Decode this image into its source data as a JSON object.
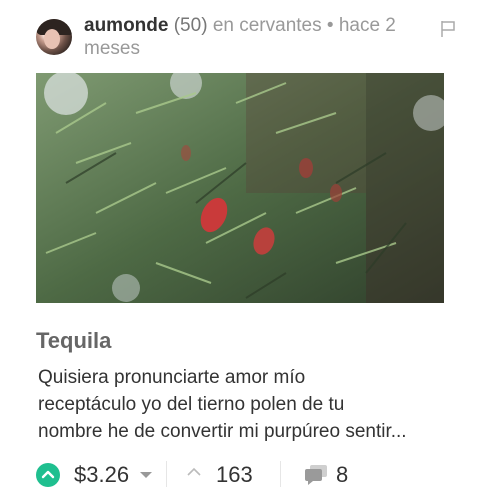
{
  "post": {
    "author": "aumonde",
    "reputation": "(50)",
    "community_prefix": "en",
    "community": "cervantes",
    "separator": "•",
    "time_line1": "hace 2",
    "time_line2": "meses",
    "title": "Tequila",
    "excerpt_lines": [
      "Quisiera pronunciarte amor mío",
      "receptáculo yo del tierno polen de tu",
      "nombre he de convertir mi purpúreo sentir..."
    ]
  },
  "footer": {
    "payout": "$3.26",
    "votes": "163",
    "comments": "8"
  },
  "colors": {
    "accent": "#1fbf8f",
    "muted_text": "#999999",
    "title_text": "#666666",
    "body_text": "#333333"
  },
  "icons": [
    "flag-icon",
    "upvote-icon",
    "caret-down-icon",
    "votes-chevron-icon",
    "comments-icon"
  ]
}
